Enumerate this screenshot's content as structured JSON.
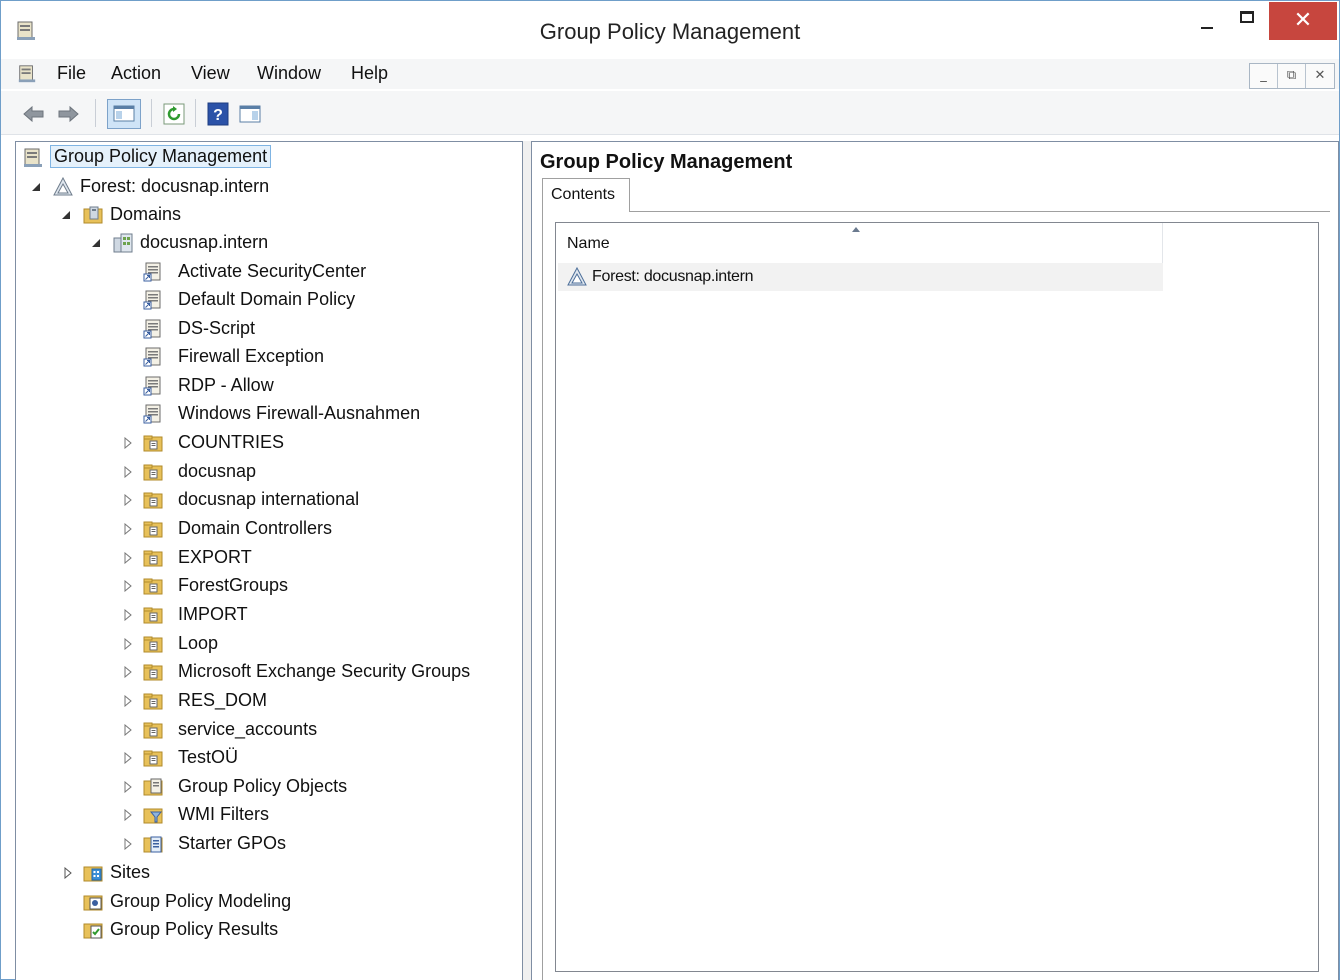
{
  "window": {
    "title": "Group Policy Management"
  },
  "title_bar": {
    "close_glyph": "✕"
  },
  "menu": {
    "items": [
      "File",
      "Action",
      "View",
      "Window",
      "Help"
    ]
  },
  "mdi_buttons": [
    "_",
    "⧉",
    "✕"
  ],
  "toolbar": {
    "buttons": [
      "back-icon",
      "forward-icon",
      "show-hide-console-tree-icon",
      "refresh-icon",
      "help-icon",
      "show-hide-action-pane-icon"
    ]
  },
  "tree": {
    "root": "Group Policy Management",
    "forest": "Forest: docusnap.intern",
    "domains": "Domains",
    "domain": "docusnap.intern",
    "gpo_links": [
      "Activate SecurityCenter",
      "Default Domain Policy",
      "DS-Script",
      "Firewall Exception",
      "RDP - Allow",
      "Windows Firewall-Ausnahmen"
    ],
    "ous": [
      "COUNTRIES",
      "docusnap",
      "docusnap international",
      "Domain Controllers",
      "EXPORT",
      "ForestGroups",
      "IMPORT",
      "Loop",
      "Microsoft Exchange Security Groups",
      "RES_DOM",
      "service_accounts",
      "TestOÜ"
    ],
    "containers": [
      "Group Policy Objects",
      "WMI Filters",
      "Starter GPOs"
    ],
    "sites": "Sites",
    "modeling": "Group Policy Modeling",
    "results": "Group Policy Results"
  },
  "right_pane": {
    "title": "Group Policy Management",
    "tab": "Contents",
    "column_name": "Name",
    "rows": [
      "Forest: docusnap.intern"
    ]
  },
  "colors": {
    "selection_fill": "#e5f1fb",
    "selection_border": "#7fb4e3",
    "close_button": "#c7463e",
    "ou_folder": "#e8c15a"
  }
}
